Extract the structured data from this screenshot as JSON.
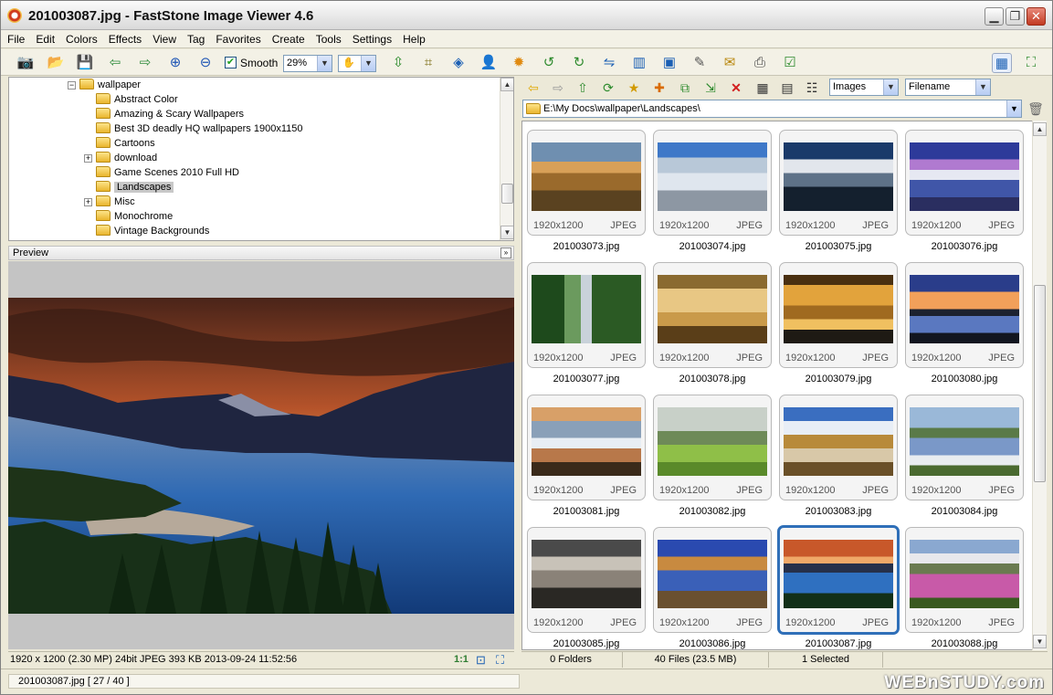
{
  "window": {
    "title": "201003087.jpg - FastStone Image Viewer 4.6"
  },
  "menu": [
    "File",
    "Edit",
    "Colors",
    "Effects",
    "View",
    "Tag",
    "Favorites",
    "Create",
    "Tools",
    "Settings",
    "Help"
  ],
  "toolbar": {
    "smooth_label": "Smooth",
    "smooth_checked": true,
    "zoom_value": "29%"
  },
  "tree": {
    "root": "wallpaper",
    "items": [
      {
        "label": "Abstract Color",
        "expandable": false
      },
      {
        "label": "Amazing & Scary Wallpapers",
        "expandable": false
      },
      {
        "label": "Best 3D deadly HQ wallpapers 1900x1150",
        "expandable": false
      },
      {
        "label": "Cartoons",
        "expandable": false
      },
      {
        "label": "download",
        "expandable": true
      },
      {
        "label": "Game Scenes 2010 Full HD",
        "expandable": false
      },
      {
        "label": "Landscapes",
        "expandable": false,
        "selected": true
      },
      {
        "label": "Misc",
        "expandable": true
      },
      {
        "label": "Monochrome",
        "expandable": false
      },
      {
        "label": "Vintage Backgrounds",
        "expandable": false
      }
    ]
  },
  "preview": {
    "header": "Preview"
  },
  "status_left": {
    "info": "1920 x 1200 (2.30 MP)  24bit  JPEG   393 KB   2013-09-24 11:52:56",
    "zoom_label": "1:1"
  },
  "browser": {
    "filter": "Images",
    "sort": "Filename",
    "path": "E:\\My Docs\\wallpaper\\Landscapes\\",
    "thumbnails": [
      {
        "name": "201003073.jpg",
        "dims": "1920x1200",
        "format": "JPEG"
      },
      {
        "name": "201003074.jpg",
        "dims": "1920x1200",
        "format": "JPEG"
      },
      {
        "name": "201003075.jpg",
        "dims": "1920x1200",
        "format": "JPEG"
      },
      {
        "name": "201003076.jpg",
        "dims": "1920x1200",
        "format": "JPEG"
      },
      {
        "name": "201003077.jpg",
        "dims": "1920x1200",
        "format": "JPEG"
      },
      {
        "name": "201003078.jpg",
        "dims": "1920x1200",
        "format": "JPEG"
      },
      {
        "name": "201003079.jpg",
        "dims": "1920x1200",
        "format": "JPEG"
      },
      {
        "name": "201003080.jpg",
        "dims": "1920x1200",
        "format": "JPEG"
      },
      {
        "name": "201003081.jpg",
        "dims": "1920x1200",
        "format": "JPEG"
      },
      {
        "name": "201003082.jpg",
        "dims": "1920x1200",
        "format": "JPEG"
      },
      {
        "name": "201003083.jpg",
        "dims": "1920x1200",
        "format": "JPEG"
      },
      {
        "name": "201003084.jpg",
        "dims": "1920x1200",
        "format": "JPEG"
      },
      {
        "name": "201003085.jpg",
        "dims": "1920x1200",
        "format": "JPEG"
      },
      {
        "name": "201003086.jpg",
        "dims": "1920x1200",
        "format": "JPEG"
      },
      {
        "name": "201003087.jpg",
        "dims": "1920x1200",
        "format": "JPEG",
        "selected": true
      },
      {
        "name": "201003088.jpg",
        "dims": "1920x1200",
        "format": "JPEG"
      }
    ]
  },
  "status_right": {
    "folders": "0 Folders",
    "files": "40 Files (23.5 MB)",
    "selected": "1 Selected"
  },
  "bottom": {
    "file_info": "201003087.jpg [ 27 / 40 ]",
    "watermark": "WEBnSTUDY.com"
  }
}
